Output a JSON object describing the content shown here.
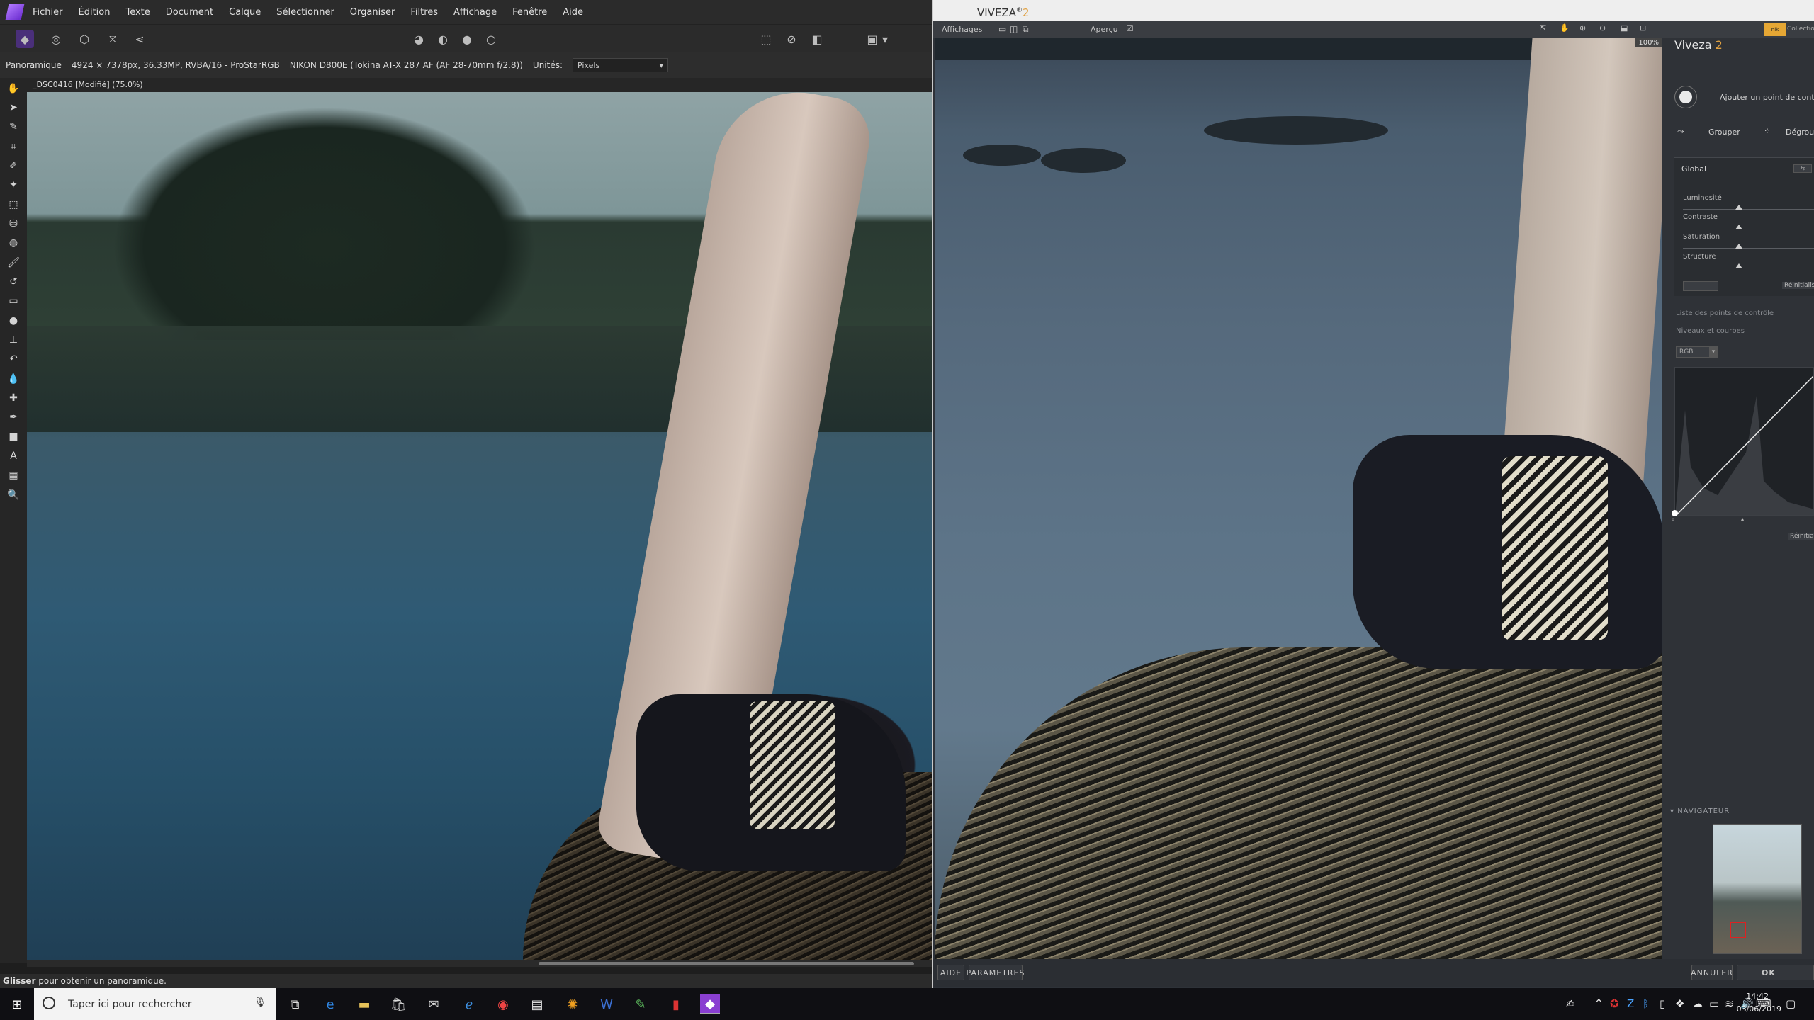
{
  "affinity": {
    "menu": [
      "Fichier",
      "Édition",
      "Texte",
      "Document",
      "Calque",
      "Sélectionner",
      "Organiser",
      "Filtres",
      "Affichage",
      "Fenêtre",
      "Aide"
    ],
    "context": {
      "tool_name": "Panoramique",
      "doc_info": "4924 × 7378px, 36.33MP, RVBA/16 - ProStarRGB",
      "camera": "NIKON D800E (Tokina AT-X 287 AF (AF 28-70mm f/2.8))",
      "units_label": "Unités:",
      "units_value": "Pixels"
    },
    "doc_tab": "_DSC0416 [Modifié] (75.0%)",
    "status": {
      "bold": "Glisser",
      "text": " pour obtenir un panoramique."
    }
  },
  "viveza": {
    "title_main": "VIVEZA",
    "title_reg": "®",
    "title_version": "2",
    "toolbar": {
      "views_label": "Affichages",
      "preview_label": "Aperçu",
      "zoom": "100%"
    },
    "panel_title": "Viveza",
    "panel_version": "2",
    "collection_label": "Collectio",
    "add_point": "Ajouter un point de cont",
    "group": "Grouper",
    "ungroup": "Dégrou",
    "global_label": "Global",
    "sliders": [
      "Luminosité",
      "Contraste",
      "Saturation",
      "Structure"
    ],
    "reset_label": "Réinitialis",
    "control_points_list": "Liste des points de contrôle",
    "levels_curves": "Niveaux et courbes",
    "channel": "RGB",
    "reset_label_2": "Réinitia",
    "navigator": "NAVIGATEUR",
    "buttons": {
      "help": "AIDE",
      "settings": "PARAMETRES",
      "cancel": "ANNULER",
      "ok": "OK"
    }
  },
  "taskbar": {
    "search_placeholder": "Taper ici pour rechercher",
    "time": "14:42",
    "date": "03/06/2019"
  }
}
